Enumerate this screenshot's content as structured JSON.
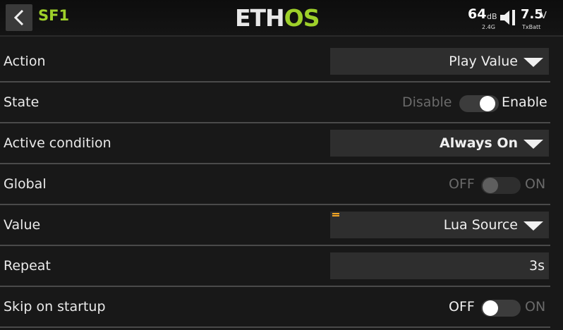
{
  "header": {
    "title": "SF1",
    "logo_a": "ETH",
    "logo_b": "OS",
    "rssi_value": "64",
    "rssi_unit": "dB",
    "rssi_band": "2.4G",
    "battery_value": "7.5",
    "battery_unit": "V",
    "battery_label": "TxBatt"
  },
  "rows": {
    "action": {
      "label": "Action",
      "value": "Play Value"
    },
    "state": {
      "label": "State",
      "off": "Disable",
      "on": "Enable",
      "enabled": true
    },
    "active_condition": {
      "label": "Active condition",
      "value": "Always On"
    },
    "global": {
      "label": "Global",
      "off": "OFF",
      "on": "ON",
      "enabled": false
    },
    "value": {
      "label": "Value",
      "value": "Lua Source"
    },
    "repeat": {
      "label": "Repeat",
      "value": "3s"
    },
    "skip_on_startup": {
      "label": "Skip on startup",
      "off": "OFF",
      "on": "ON",
      "enabled": false
    }
  },
  "colors": {
    "accent": "#9ed02a",
    "background": "#181818",
    "field": "#2e2e2e",
    "lua_icon": "#f5a623"
  }
}
